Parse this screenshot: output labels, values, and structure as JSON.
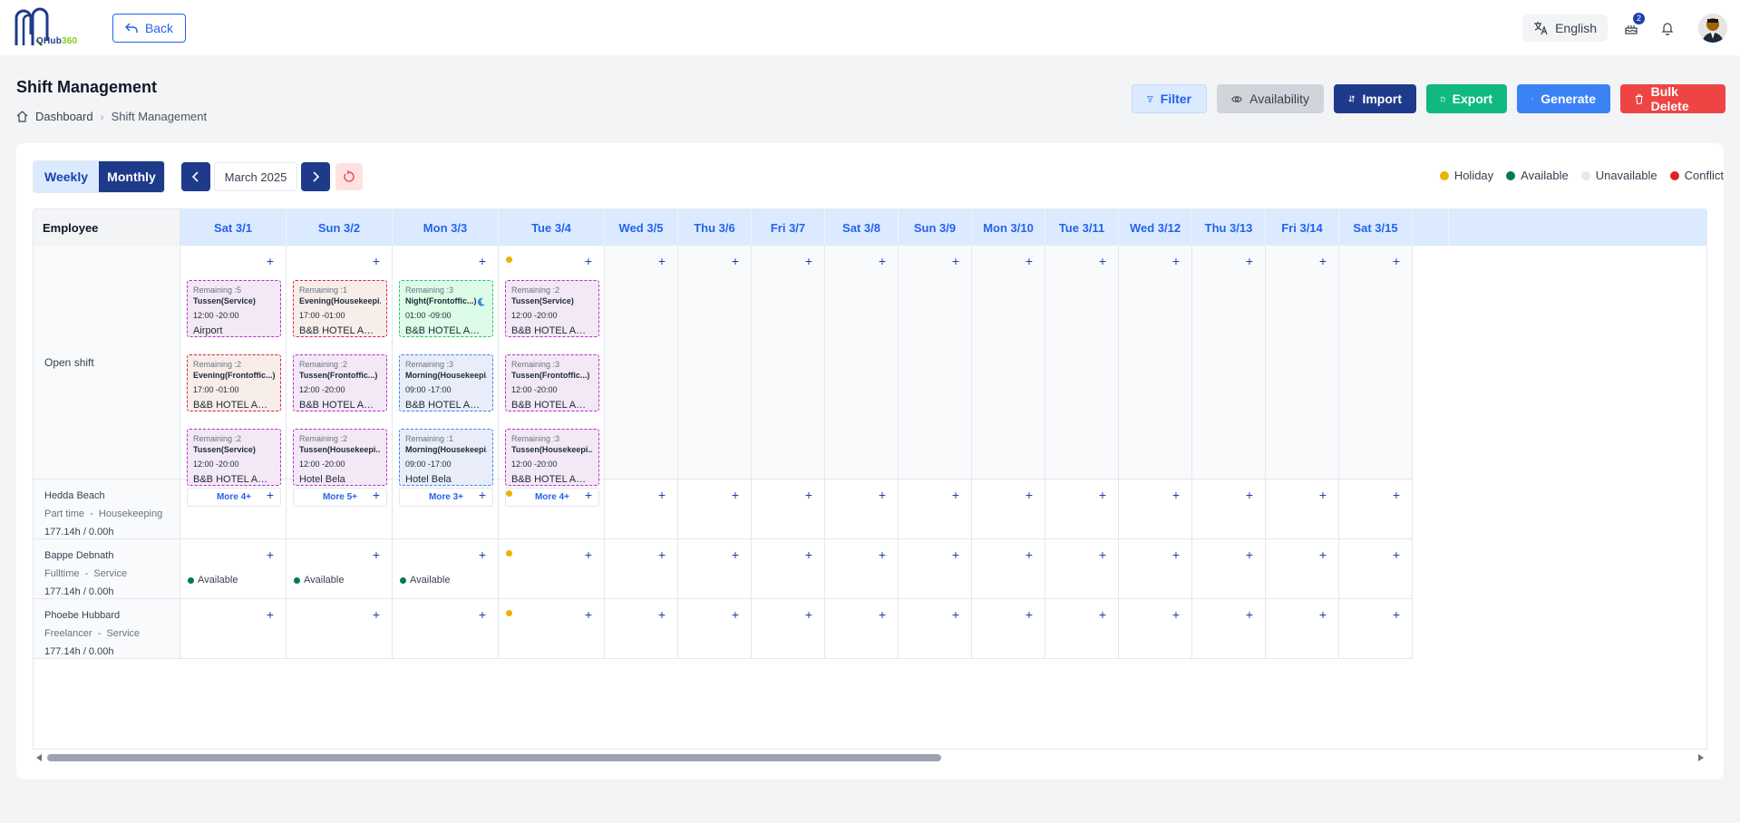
{
  "app": {
    "logo_text": "QHub",
    "logo_suffix": "360",
    "back_label": "Back",
    "language": "English",
    "notification_count": "2"
  },
  "page": {
    "title": "Shift Management",
    "breadcrumb": [
      "Dashboard",
      "Shift Management"
    ]
  },
  "actions": {
    "filter": "Filter",
    "availability": "Availability",
    "import": "Import",
    "export": "Export",
    "generate": "Generate",
    "bulk_delete": "Bulk Delete"
  },
  "view": {
    "weekly": "Weekly",
    "monthly": "Monthly",
    "active": "Monthly",
    "month": "March 2025"
  },
  "legend": [
    {
      "label": "Holiday",
      "color": "#eab308"
    },
    {
      "label": "Available",
      "color": "#047857"
    },
    {
      "label": "Unavailable",
      "color": "#e5e7eb"
    },
    {
      "label": "Conflict",
      "color": "#dc2626"
    }
  ],
  "grid": {
    "employee_header": "Employee",
    "days": [
      "Sat 3/1",
      "Sun 3/2",
      "Mon 3/3",
      "Tue 3/4",
      "Wed 3/5",
      "Thu 3/6",
      "Fri 3/7",
      "Sat 3/8",
      "Sun 3/9",
      "Mon 3/10",
      "Tue 3/11",
      "Wed 3/12",
      "Thu 3/13",
      "Fri 3/14",
      "Sat 3/15"
    ],
    "holiday_days": [
      3
    ],
    "open_shift_label": "Open shift",
    "open_shifts": [
      {
        "more": "More 4+",
        "shifts": [
          {
            "remaining": "Remaining :5",
            "name": "Tussen(Service)",
            "time": "12:00 -20:00",
            "location": "Airport",
            "color": "pink"
          },
          {
            "remaining": "Remaining :2",
            "name": "Evening(Frontoffic...)",
            "time": "17:00 -01:00",
            "location": "B&B HOTEL Amsterdam",
            "color": "peach"
          },
          {
            "remaining": "Remaining :2",
            "name": "Tussen(Service)",
            "time": "12:00 -20:00",
            "location": "B&B HOTEL Amsterdam",
            "color": "pink"
          }
        ]
      },
      {
        "more": "More 5+",
        "shifts": [
          {
            "remaining": "Remaining :1",
            "name": "Evening(Housekeepi...)",
            "time": "17:00 -01:00",
            "location": "B&B HOTEL Amsterdam",
            "color": "peach"
          },
          {
            "remaining": "Remaining :2",
            "name": "Tussen(Frontoffic...)",
            "time": "12:00 -20:00",
            "location": "B&B HOTEL Amsterdam",
            "color": "pink"
          },
          {
            "remaining": "Remaining :2",
            "name": "Tussen(Housekeepi...)",
            "time": "12:00 -20:00",
            "location": "Hotel Bela",
            "color": "pink"
          }
        ]
      },
      {
        "more": "More 3+",
        "shifts": [
          {
            "remaining": "Remaining :3",
            "name": "Night(Frontoffic...)",
            "time": "01:00 -09:00",
            "location": "B&B HOTEL Amsterdam",
            "color": "green",
            "night": true
          },
          {
            "remaining": "Remaining :3",
            "name": "Morning(Housekeepi...)",
            "time": "09:00 -17:00",
            "location": "B&B HOTEL Amsterdam",
            "color": "blue"
          },
          {
            "remaining": "Remaining :1",
            "name": "Morning(Housekeepi...)",
            "time": "09:00 -17:00",
            "location": "Hotel Bela",
            "color": "blue"
          }
        ]
      },
      {
        "more": "More 4+",
        "shifts": [
          {
            "remaining": "Remaining :2",
            "name": "Tussen(Service)",
            "time": "12:00 -20:00",
            "location": "B&B HOTEL Amsterdam",
            "color": "pink"
          },
          {
            "remaining": "Remaining :3",
            "name": "Tussen(Frontoffic...)",
            "time": "12:00 -20:00",
            "location": "B&B HOTEL Amsterdam",
            "color": "pink"
          },
          {
            "remaining": "Remaining :3",
            "name": "Tussen(Housekeepi...)",
            "time": "12:00 -20:00",
            "location": "B&B HOTEL Amsterdam",
            "color": "pink"
          }
        ]
      }
    ],
    "employees": [
      {
        "name": "Hedda Beach",
        "type": "Part time",
        "dept": "Housekeeping",
        "hours": "177.14h / 0.00h",
        "available_days": []
      },
      {
        "name": "Bappe Debnath",
        "type": "Fulltime",
        "dept": "Service",
        "hours": "177.14h / 0.00h",
        "available_days": [
          0,
          1,
          2
        ]
      },
      {
        "name": "Phoebe Hubbard",
        "type": "Freelancer",
        "dept": "Service",
        "hours": "177.14h / 0.00h",
        "available_days": []
      }
    ],
    "available_label": "Available"
  }
}
